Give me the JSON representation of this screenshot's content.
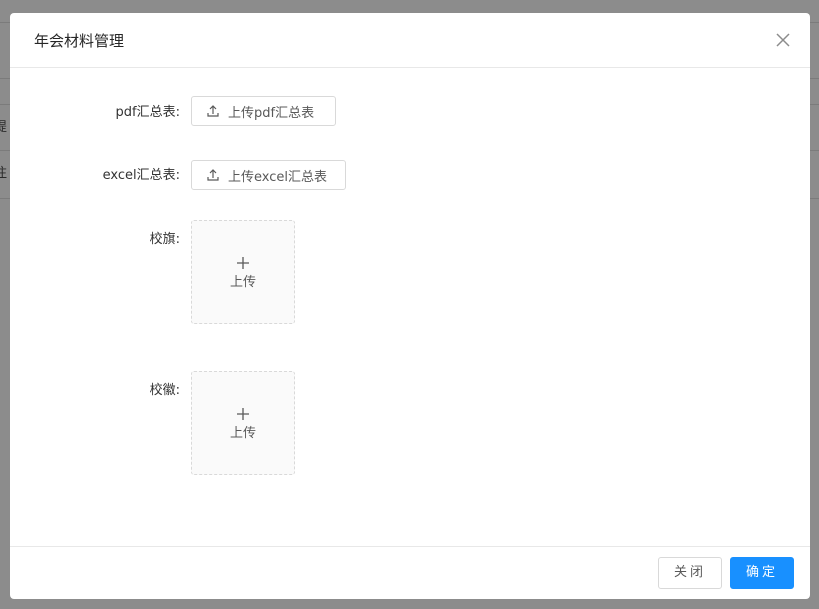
{
  "background": {
    "partial_chars": [
      "提",
      "注"
    ]
  },
  "modal": {
    "title": "年会材料管理",
    "close_icon": "close-icon"
  },
  "form": {
    "pdf": {
      "label": "pdf汇总表:",
      "button_label": "上传pdf汇总表",
      "icon": "upload-icon"
    },
    "excel": {
      "label": "excel汇总表:",
      "button_label": "上传excel汇总表",
      "icon": "upload-icon"
    },
    "flag": {
      "label": "校旗:",
      "upload_text": "上传",
      "icon": "plus-icon"
    },
    "emblem": {
      "label": "校徽:",
      "upload_text": "上传",
      "icon": "plus-icon"
    }
  },
  "footer": {
    "close_label": "关闭",
    "ok_label": "确定"
  },
  "colors": {
    "primary": "#1890ff",
    "border": "#d9d9d9",
    "overlay": "#7f7f7f"
  }
}
